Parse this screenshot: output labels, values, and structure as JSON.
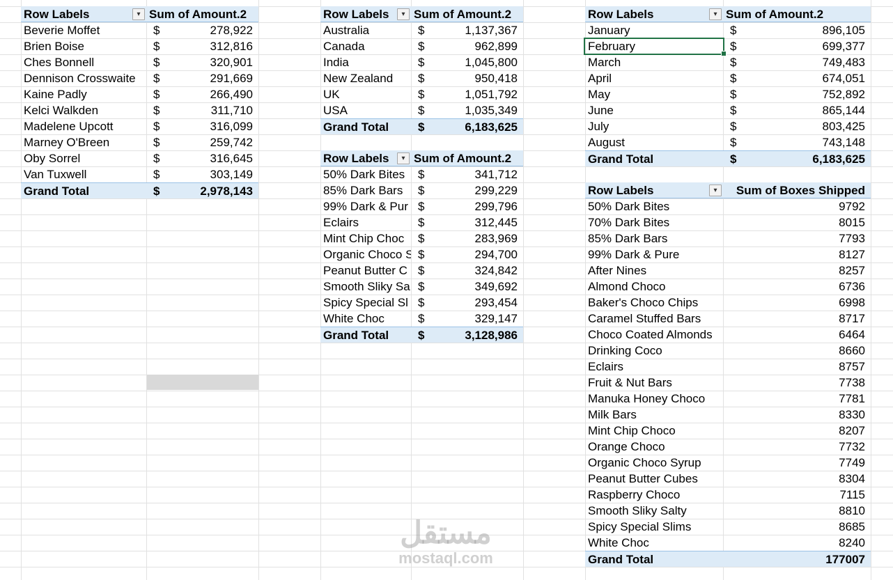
{
  "pivot_reps": {
    "header_label": "Row Labels",
    "header_value": "Sum of Amount.2",
    "currency": "$",
    "rows": [
      {
        "label": "Beverie Moffet",
        "value": "278,922"
      },
      {
        "label": "Brien Boise",
        "value": "312,816"
      },
      {
        "label": "Ches Bonnell",
        "value": "320,901"
      },
      {
        "label": "Dennison Crosswaite",
        "value": "291,669"
      },
      {
        "label": "Kaine Padly",
        "value": "266,490"
      },
      {
        "label": "Kelci Walkden",
        "value": "311,710"
      },
      {
        "label": "Madelene Upcott",
        "value": "316,099"
      },
      {
        "label": "Marney O'Breen",
        "value": "259,742"
      },
      {
        "label": "Oby Sorrel",
        "value": "316,645"
      },
      {
        "label": "Van Tuxwell",
        "value": "303,149"
      }
    ],
    "total_label": "Grand Total",
    "total_value": "2,978,143"
  },
  "pivot_countries": {
    "header_label": "Row Labels",
    "header_value": "Sum of Amount.2",
    "currency": "$",
    "rows": [
      {
        "label": "Australia",
        "value": "1,137,367"
      },
      {
        "label": "Canada",
        "value": "962,899"
      },
      {
        "label": "India",
        "value": "1,045,800"
      },
      {
        "label": "New Zealand",
        "value": "950,418"
      },
      {
        "label": "UK",
        "value": "1,051,792"
      },
      {
        "label": "USA",
        "value": "1,035,349"
      }
    ],
    "total_label": "Grand Total",
    "total_value": "6,183,625"
  },
  "pivot_products": {
    "header_label": "Row Labels",
    "header_value": "Sum of Amount.2",
    "currency": "$",
    "rows": [
      {
        "label": "50% Dark Bites",
        "value": "341,712"
      },
      {
        "label": "85% Dark Bars",
        "value": "299,229"
      },
      {
        "label": "99% Dark & Pur",
        "value": "299,796"
      },
      {
        "label": "Eclairs",
        "value": "312,445"
      },
      {
        "label": "Mint Chip Choc",
        "value": "283,969"
      },
      {
        "label": "Organic Choco S",
        "value": "294,700"
      },
      {
        "label": "Peanut Butter C",
        "value": "324,842"
      },
      {
        "label": "Smooth Sliky Sa",
        "value": "349,692"
      },
      {
        "label": "Spicy Special Sl",
        "value": "293,454"
      },
      {
        "label": "White Choc",
        "value": "329,147"
      }
    ],
    "total_label": "Grand Total",
    "total_value": "3,128,986"
  },
  "pivot_months": {
    "header_label": "Row Labels",
    "header_value": "Sum of Amount.2",
    "currency": "$",
    "rows": [
      {
        "label": "January",
        "value": "896,105"
      },
      {
        "label": "February",
        "value": "699,377"
      },
      {
        "label": "March",
        "value": "749,483"
      },
      {
        "label": "April",
        "value": "674,051"
      },
      {
        "label": "May",
        "value": "752,892"
      },
      {
        "label": "June",
        "value": "865,144"
      },
      {
        "label": "July",
        "value": "803,425"
      },
      {
        "label": "August",
        "value": "743,148"
      }
    ],
    "total_label": "Grand Total",
    "total_value": "6,183,625"
  },
  "pivot_boxes": {
    "header_label": "Row Labels",
    "header_value": "Sum of Boxes Shipped",
    "rows": [
      {
        "label": "50% Dark Bites",
        "value": "9792"
      },
      {
        "label": "70% Dark Bites",
        "value": "8015"
      },
      {
        "label": "85% Dark Bars",
        "value": "7793"
      },
      {
        "label": "99% Dark & Pure",
        "value": "8127"
      },
      {
        "label": "After Nines",
        "value": "8257"
      },
      {
        "label": "Almond Choco",
        "value": "6736"
      },
      {
        "label": "Baker's Choco Chips",
        "value": "6998"
      },
      {
        "label": "Caramel Stuffed Bars",
        "value": "8717"
      },
      {
        "label": "Choco Coated Almonds",
        "value": "6464"
      },
      {
        "label": "Drinking Coco",
        "value": "8660"
      },
      {
        "label": "Eclairs",
        "value": "8757"
      },
      {
        "label": "Fruit & Nut Bars",
        "value": "7738"
      },
      {
        "label": "Manuka Honey Choco",
        "value": "7781"
      },
      {
        "label": "Milk Bars",
        "value": "8330"
      },
      {
        "label": "Mint Chip Choco",
        "value": "8207"
      },
      {
        "label": "Orange Choco",
        "value": "7732"
      },
      {
        "label": "Organic Choco Syrup",
        "value": "7749"
      },
      {
        "label": "Peanut Butter Cubes",
        "value": "8304"
      },
      {
        "label": "Raspberry Choco",
        "value": "7115"
      },
      {
        "label": "Smooth Sliky Salty",
        "value": "8810"
      },
      {
        "label": "Spicy Special Slims",
        "value": "8685"
      },
      {
        "label": "White Choc",
        "value": "8240"
      }
    ],
    "total_label": "Grand Total",
    "total_value": "177007"
  },
  "icons": {
    "filter_applied": "funnel-filter-icon",
    "dropdown": "chevron-down-icon",
    "sort_desc": "sort-descending-icon"
  },
  "watermark": {
    "arabic": "مستقل",
    "latin": "mostaql.com"
  },
  "colors": {
    "pivot_header_bg": "#ddebf7",
    "pivot_border": "#9bc2e6",
    "gridline": "#e1e1e1",
    "selection": "#217346",
    "gray_fill": "#d9d9d9"
  }
}
